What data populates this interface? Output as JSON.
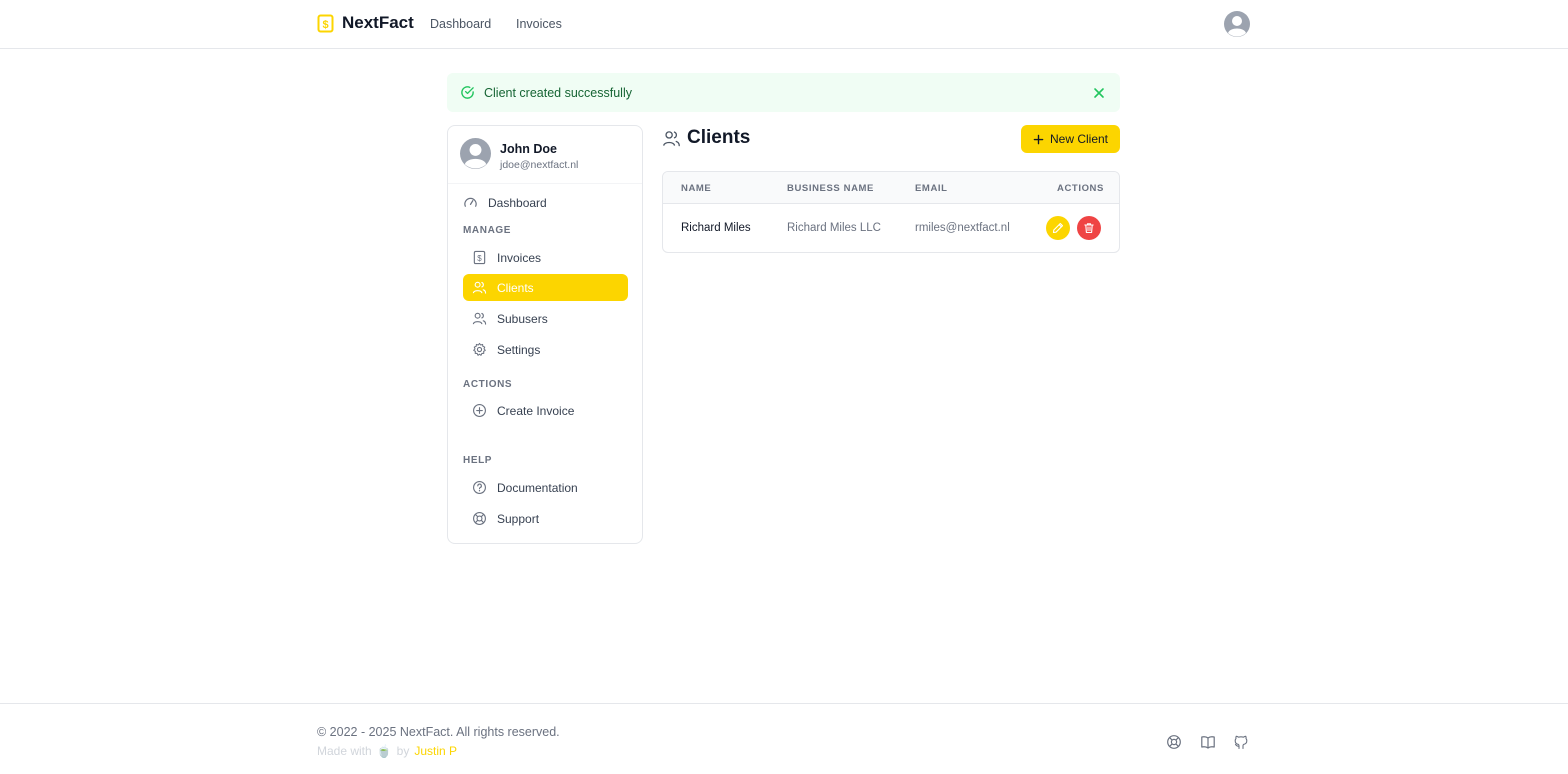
{
  "header": {
    "brand": "NextFact",
    "nav": [
      "Dashboard",
      "Invoices"
    ]
  },
  "alert": {
    "message": "Client created successfully"
  },
  "sidebar": {
    "user": {
      "name": "John Doe",
      "email": "jdoe@nextfact.nl"
    },
    "dashboard_label": "Dashboard",
    "manage_label": "MANAGE",
    "manage_items": [
      "Invoices",
      "Clients",
      "Subusers",
      "Settings"
    ],
    "actions_label": "ACTIONS",
    "actions_items": [
      "Create Invoice"
    ],
    "help_label": "HELP",
    "help_items": [
      "Documentation",
      "Support"
    ],
    "active_item": "Clients"
  },
  "main": {
    "title": "Clients",
    "new_button": "New Client",
    "table": {
      "headers": [
        "NAME",
        "BUSINESS NAME",
        "EMAIL",
        "ACTIONS"
      ],
      "rows": [
        {
          "name": "Richard Miles",
          "business": "Richard Miles LLC",
          "email": "rmiles@nextfact.nl"
        }
      ]
    }
  },
  "footer": {
    "copyright": "© 2022 - 2025 NextFact. All rights reserved.",
    "made_with": "Made with",
    "made_with_icon": "🍵",
    "by": "by",
    "author": "Justin P",
    "icons": [
      "lifebuoy-icon",
      "book-icon",
      "github-icon"
    ]
  },
  "colors": {
    "accent": "#fcd500",
    "danger": "#ef4444",
    "success_bg": "#f0fdf4",
    "success_text": "#166534"
  }
}
